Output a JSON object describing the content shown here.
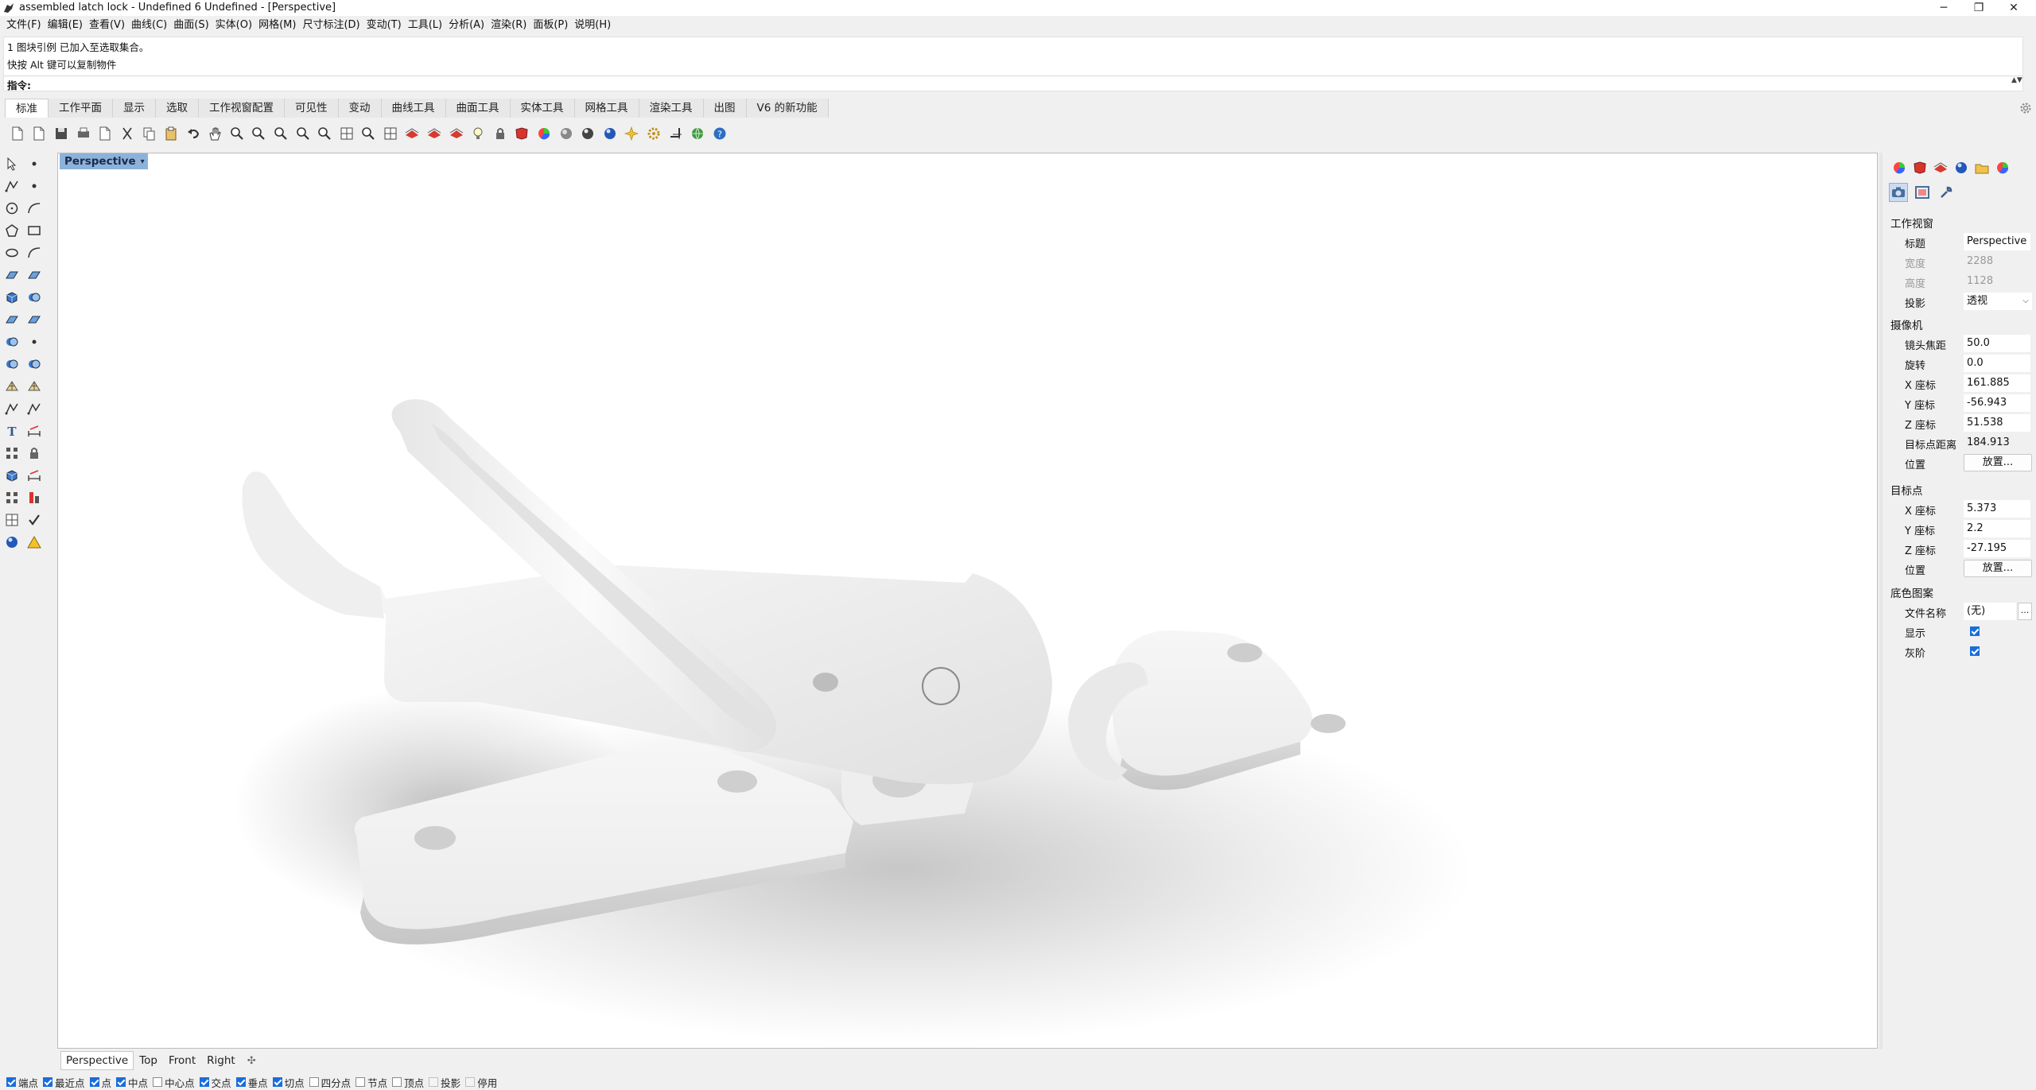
{
  "window": {
    "title": "assembled latch lock - Undefined 6 Undefined - [Perspective]",
    "controls": [
      "─",
      "❐",
      "✕"
    ]
  },
  "menu": [
    "文件(F)",
    "编辑(E)",
    "查看(V)",
    "曲线(C)",
    "曲面(S)",
    "实体(O)",
    "网格(M)",
    "尺寸标注(D)",
    "变动(T)",
    "工具(L)",
    "分析(A)",
    "渲染(R)",
    "面板(P)",
    "说明(H)"
  ],
  "command": {
    "history": [
      "1 图块引例 已加入至选取集合。",
      "快按 Alt 键可以复制物件"
    ],
    "prompt_label": "指令:",
    "input_value": "",
    "scroll_glyph": "▲▼"
  },
  "tabs": [
    "标准",
    "工作平面",
    "显示",
    "选取",
    "工作视窗配置",
    "可见性",
    "变动",
    "曲线工具",
    "曲面工具",
    "实体工具",
    "网格工具",
    "渲染工具",
    "出图",
    "V6 的新功能"
  ],
  "active_tab": "标准",
  "toolbar_icons": [
    "new-file-icon",
    "open-file-icon",
    "save-icon",
    "print-icon",
    "export-icon",
    "cut-icon",
    "copy-icon",
    "paste-icon",
    "undo-icon",
    "pan-hand-icon",
    "rotate-view-icon",
    "zoom-icon",
    "zoom-window-icon",
    "zoom-extents-icon",
    "zoom-selected-icon",
    "four-views-icon",
    "rotate-camera-icon",
    "grid-icon",
    "hide-object-icon",
    "ghost-icon",
    "layer-icon",
    "light-icon",
    "lock-icon",
    "material-icon",
    "color-wheel-icon",
    "shaded-sphere-icon",
    "rendered-sphere-icon",
    "render-sphere-icon",
    "sparkle-icon",
    "gear-bolt-icon",
    "transform-icon",
    "globe-icon",
    "help-icon"
  ],
  "left_palette": [
    "select-arrow-icon",
    "point-icon",
    "polyline-icon",
    "curve-point-icon",
    "circle-icon",
    "arc-icon",
    "polygon-icon",
    "rectangle-icon",
    "ellipse-icon",
    "fillet-icon",
    "surface-icon",
    "surface-edge-icon",
    "box-solid-icon",
    "boolean-icon",
    "extrude-icon",
    "offset-surface-icon",
    "explode-icon",
    "edit-point-icon",
    "join-icon",
    "split-icon",
    "mesh-icon",
    "mesh-edit-icon",
    "curve-tool-icon",
    "curve-extend-icon",
    "text-icon",
    "dimension-icon",
    "group-icon",
    "block-icon",
    "solid-cylinder-icon",
    "measure-icon",
    "array-icon",
    "analyze-icon",
    "layer-panel-icon",
    "check-icon",
    "render-icon",
    "warning-icon"
  ],
  "viewport": {
    "name": "Perspective",
    "dropdown_glyph": "▾"
  },
  "viewport_tabs": [
    "Perspective",
    "Top",
    "Front",
    "Right"
  ],
  "active_viewport_tab": "Perspective",
  "osnap": [
    {
      "label": "端点",
      "checked": true
    },
    {
      "label": "最近点",
      "checked": true
    },
    {
      "label": "点",
      "checked": true
    },
    {
      "label": "中点",
      "checked": true
    },
    {
      "label": "中心点",
      "checked": false
    },
    {
      "label": "交点",
      "checked": true
    },
    {
      "label": "垂点",
      "checked": true
    },
    {
      "label": "切点",
      "checked": true
    },
    {
      "label": "四分点",
      "checked": false
    },
    {
      "label": "节点",
      "checked": false
    },
    {
      "label": "顶点",
      "checked": false
    },
    {
      "label": "投影",
      "checked": false,
      "disabled": true
    },
    {
      "label": "停用",
      "checked": false,
      "disabled": true
    }
  ],
  "panel": {
    "tab_icons": [
      "properties-icon",
      "material-ball-icon",
      "layers-icon",
      "render-icon",
      "folder-icon",
      "display-icon"
    ],
    "viewport_section": {
      "heading": "工作视窗",
      "title_label": "标题",
      "title_value": "Perspective",
      "width_label": "宽度",
      "width_value": "2288",
      "height_label": "高度",
      "height_value": "1128",
      "projection_label": "投影",
      "projection_value": "透视"
    },
    "camera_section": {
      "heading": "摄像机",
      "focal_label": "镜头焦距",
      "focal_value": "50.0",
      "rotation_label": "旋转",
      "rotation_value": "0.0",
      "x_label": "X 座标",
      "x_value": "161.885",
      "y_label": "Y 座标",
      "y_value": "-56.943",
      "z_label": "Z 座标",
      "z_value": "51.538",
      "target_distance_label": "目标点距离",
      "target_distance_value": "184.913",
      "position_label": "位置",
      "position_button": "放置..."
    },
    "target_section": {
      "heading": "目标点",
      "x_label": "X 座标",
      "x_value": "5.373",
      "y_label": "Y 座标",
      "y_value": "2.2",
      "z_label": "Z 座标",
      "z_value": "-27.195",
      "position_label": "位置",
      "position_button": "放置..."
    },
    "wallpaper_section": {
      "heading": "底色图案",
      "filename_label": "文件名称",
      "filename_value": "(无)",
      "browse_glyph": "...",
      "show_label": "显示",
      "show_checked": true,
      "grayscale_label": "灰阶",
      "grayscale_checked": true
    }
  },
  "colors": {
    "viewport_title_bg": "#8db2da",
    "checkbox_accent": "#1a6ddb",
    "model_white": "#f4f4f4"
  }
}
